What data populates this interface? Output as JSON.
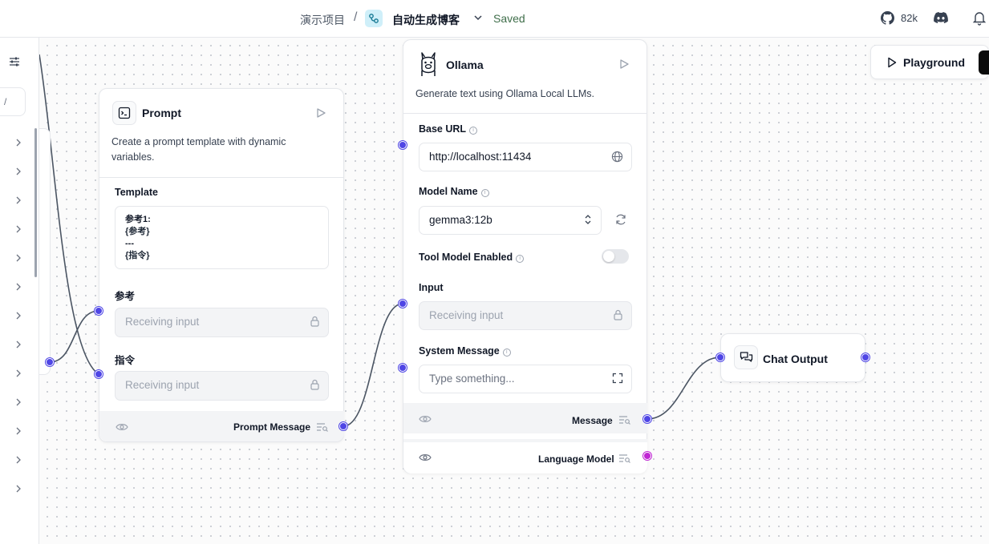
{
  "header": {
    "project": "演示项目",
    "separator": "/",
    "flow_name": "自动生成博客",
    "status": "Saved",
    "github_stars": "82k",
    "icons": [
      "flow-icon",
      "chevron-down-icon",
      "github-icon",
      "discord-icon",
      "bell-icon"
    ]
  },
  "sidebar": {
    "search_placeholder": "/",
    "icons": [
      "settings-sliders-icon",
      "chevron-right-icon"
    ],
    "category_count": 13
  },
  "playground": {
    "label": "Playground"
  },
  "prompt_node": {
    "title": "Prompt",
    "description": "Create a prompt template with dynamic variables.",
    "template_label": "Template",
    "template_lines": [
      "参考1:",
      "{参考}",
      "---",
      "{指令}"
    ],
    "field1_label": "参考",
    "field1_value": "Receiving input",
    "field2_label": "指令",
    "field2_value": "Receiving input",
    "output_label": "Prompt Message"
  },
  "ollama_node": {
    "title": "Ollama",
    "description": "Generate text using Ollama Local LLMs.",
    "base_url_label": "Base URL",
    "base_url_value": "http://localhost:11434",
    "model_label": "Model Name",
    "model_value": "gemma3:12b",
    "tool_label": "Tool Model Enabled",
    "tool_enabled": false,
    "input_label": "Input",
    "input_value": "Receiving input",
    "system_label": "System Message",
    "system_placeholder": "Type something...",
    "output1_label": "Message",
    "output2_label": "Language Model"
  },
  "chat_output_node": {
    "title": "Chat Output"
  },
  "colors": {
    "handle": "#4f46e5",
    "handle_model": "#c026d3",
    "saved": "#3f6e4a",
    "canvas_dot": "#c9cdd3"
  }
}
